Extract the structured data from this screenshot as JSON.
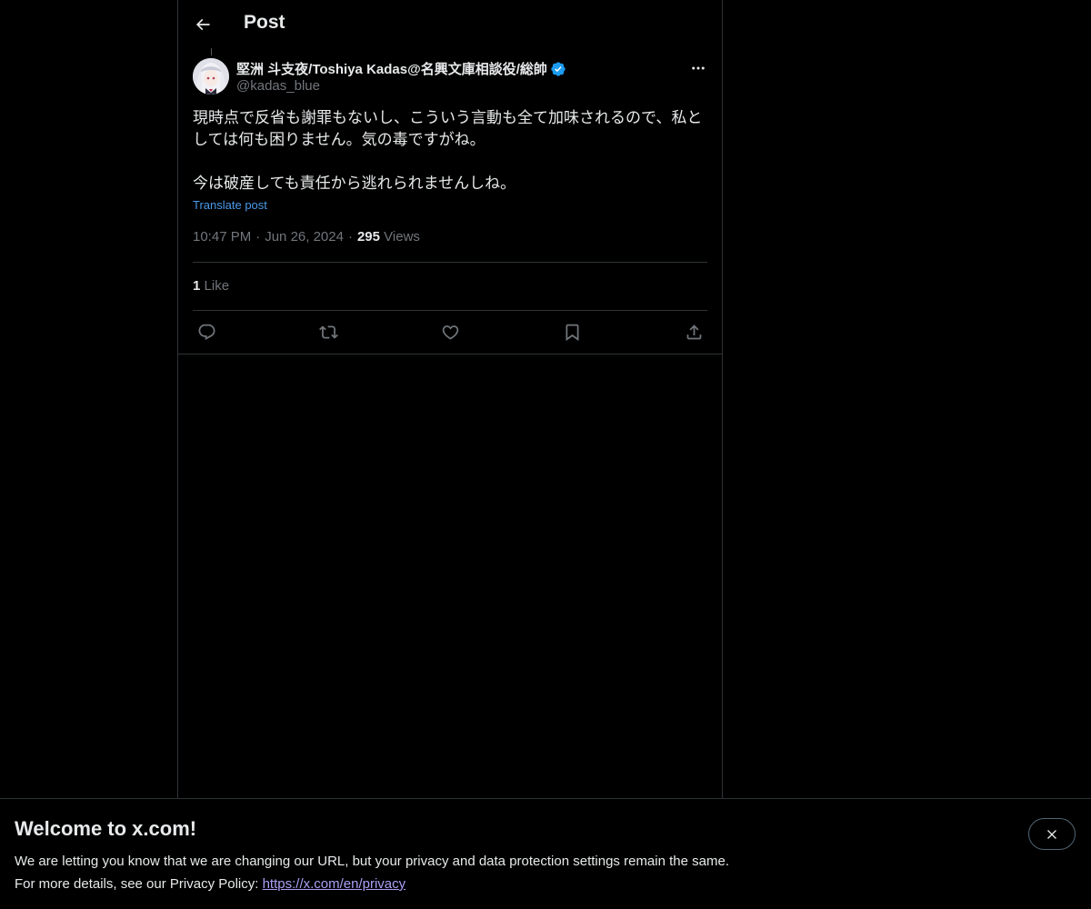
{
  "header": {
    "title": "Post",
    "back_icon": "arrow-left-icon"
  },
  "post": {
    "author": {
      "name": "堅洲 斗支夜/Toshiya Kadas@名興文庫相談役/総帥",
      "handle": "@kadas_blue",
      "verified": true,
      "verified_color": "#1d9bf0"
    },
    "text_lines": [
      "現時点で反省も謝罪もないし、こういう言動も全て加味されるので、私と",
      "しては何も困りません。気の毒ですがね。",
      "今は破産しても責任から逃れられませんしね。"
    ],
    "translate_label": "Translate post",
    "time": "10:47 PM",
    "date": "Jun 26, 2024",
    "views_count": "295",
    "views_label": "Views",
    "likes_count": "1",
    "likes_label": "Like"
  },
  "actions": [
    {
      "name": "reply-icon"
    },
    {
      "name": "repost-icon"
    },
    {
      "name": "like-icon"
    },
    {
      "name": "bookmark-icon"
    },
    {
      "name": "share-icon"
    }
  ],
  "banner": {
    "title": "Welcome to x.com!",
    "line1": "We are letting you know that we are changing our URL, but your privacy and data protection settings remain the same.",
    "line2_prefix": "For more details, see our Privacy Policy: ",
    "link_text": "https://x.com/en/privacy",
    "close_icon": "close-icon"
  },
  "colors": {
    "background": "#000000",
    "text": "#e7e9ea",
    "muted": "#71767b",
    "link": "#4a99e9",
    "border": "#2f3336"
  }
}
